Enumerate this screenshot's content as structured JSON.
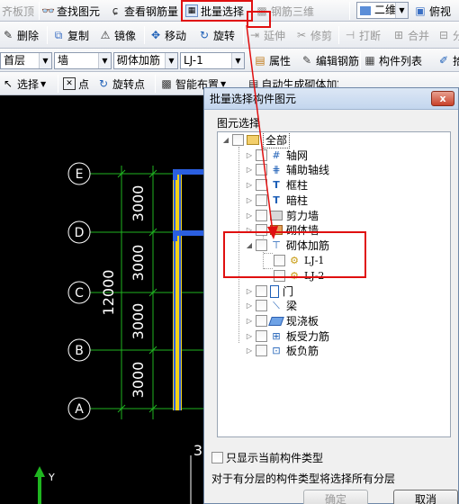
{
  "toolbar1": {
    "items": [
      "齐板顶",
      "查找图元",
      "查看钢筋量",
      "批量选择",
      "钢筋三维"
    ],
    "view_mode": "二维",
    "view_label": "俯视"
  },
  "toolbar2": {
    "items": [
      "删除",
      "复制",
      "镜像",
      "移动",
      "旋转",
      "延伸",
      "修剪",
      "打断",
      "合并",
      "分"
    ]
  },
  "toolbar3": {
    "floor": "首层",
    "category": "墙",
    "type": "砌体加筋",
    "name": "LJ-1",
    "buttons": [
      "属性",
      "编辑钢筋",
      "构件列表",
      "拾"
    ]
  },
  "toolbar4": {
    "items": [
      "选择",
      "点",
      "旋转点",
      "智能布置",
      "自动生成砌体加筋"
    ]
  },
  "canvas": {
    "axes": [
      "E",
      "D",
      "C",
      "B",
      "A"
    ],
    "dims": [
      "3000",
      "3000",
      "3000",
      "3000"
    ],
    "total": "12000",
    "partial_dim": "3",
    "y_label": "Y"
  },
  "dialog": {
    "title": "批量选择构件图元",
    "close": "x",
    "group_label": "图元选择",
    "tree": {
      "root": "全部",
      "items": [
        "轴网",
        "辅助轴线",
        "框柱",
        "暗柱",
        "剪力墙",
        "砌体墙",
        "砌体加筋",
        "门",
        "梁",
        "现浇板",
        "板受力筋",
        "板负筋"
      ],
      "children": [
        "LJ-1",
        "LJ-2"
      ]
    },
    "only_current_label": "只显示当前构件类型",
    "note": "对于有分层的构件类型将选择所有分层",
    "ok": "确定",
    "cancel": "取消"
  },
  "colors": {
    "canvas_bg": "#000000",
    "grid_line": "#1fb520",
    "wall": "#2b5fe0",
    "hatch": "#f3d21a",
    "highlight": "#e01010"
  }
}
